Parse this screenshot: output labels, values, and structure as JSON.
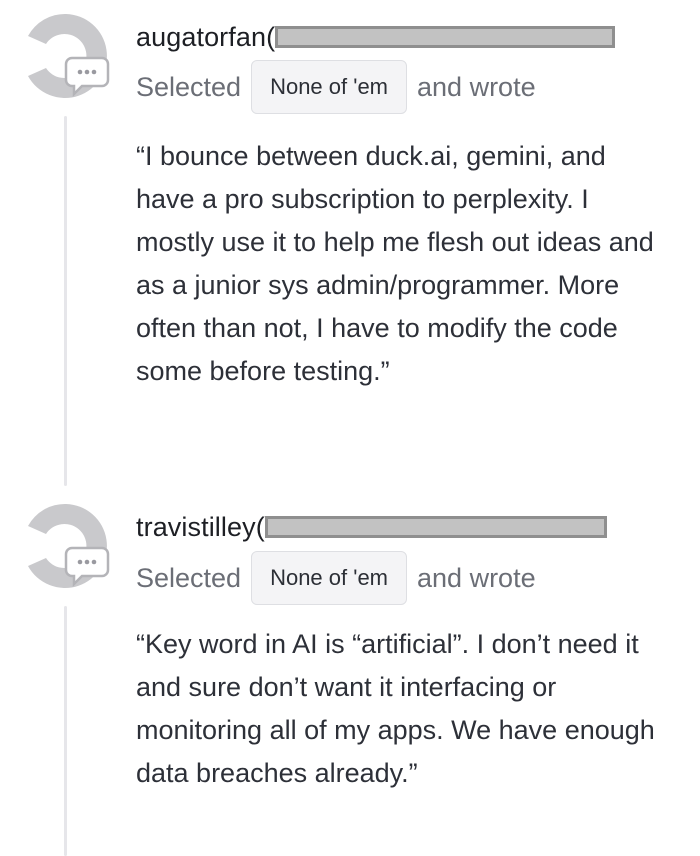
{
  "comments": [
    {
      "username": "augatorfan(",
      "selected_prefix": "Selected",
      "choice": "None of 'em",
      "selected_suffix": "and wrote",
      "quote": "“I bounce between duck.ai, gemini, and have a pro subscription to perplexity. I mostly use it to help me flesh out ideas and as a junior sys admin/programmer. More often than not, I have to modify the code some before testing.”",
      "avatar_icon": "default-avatar-icon",
      "badge_icon": "comment-bubble-icon"
    },
    {
      "username": "travistilley(",
      "selected_prefix": "Selected",
      "choice": "None of 'em",
      "selected_suffix": "and wrote",
      "quote": "“Key word in AI is “artificial”. I don’t need it and sure don’t want it interfacing or monitoring all of my apps. We have enough data breaches already.”",
      "avatar_icon": "default-avatar-icon",
      "badge_icon": "comment-bubble-icon"
    }
  ],
  "colors": {
    "avatar_gray": "#c9c9cc",
    "redaction_fill": "#c2c2c2",
    "redaction_border": "#8f8f8f",
    "thread_line": "#e6e6ea",
    "pill_bg": "#f4f4f6"
  }
}
